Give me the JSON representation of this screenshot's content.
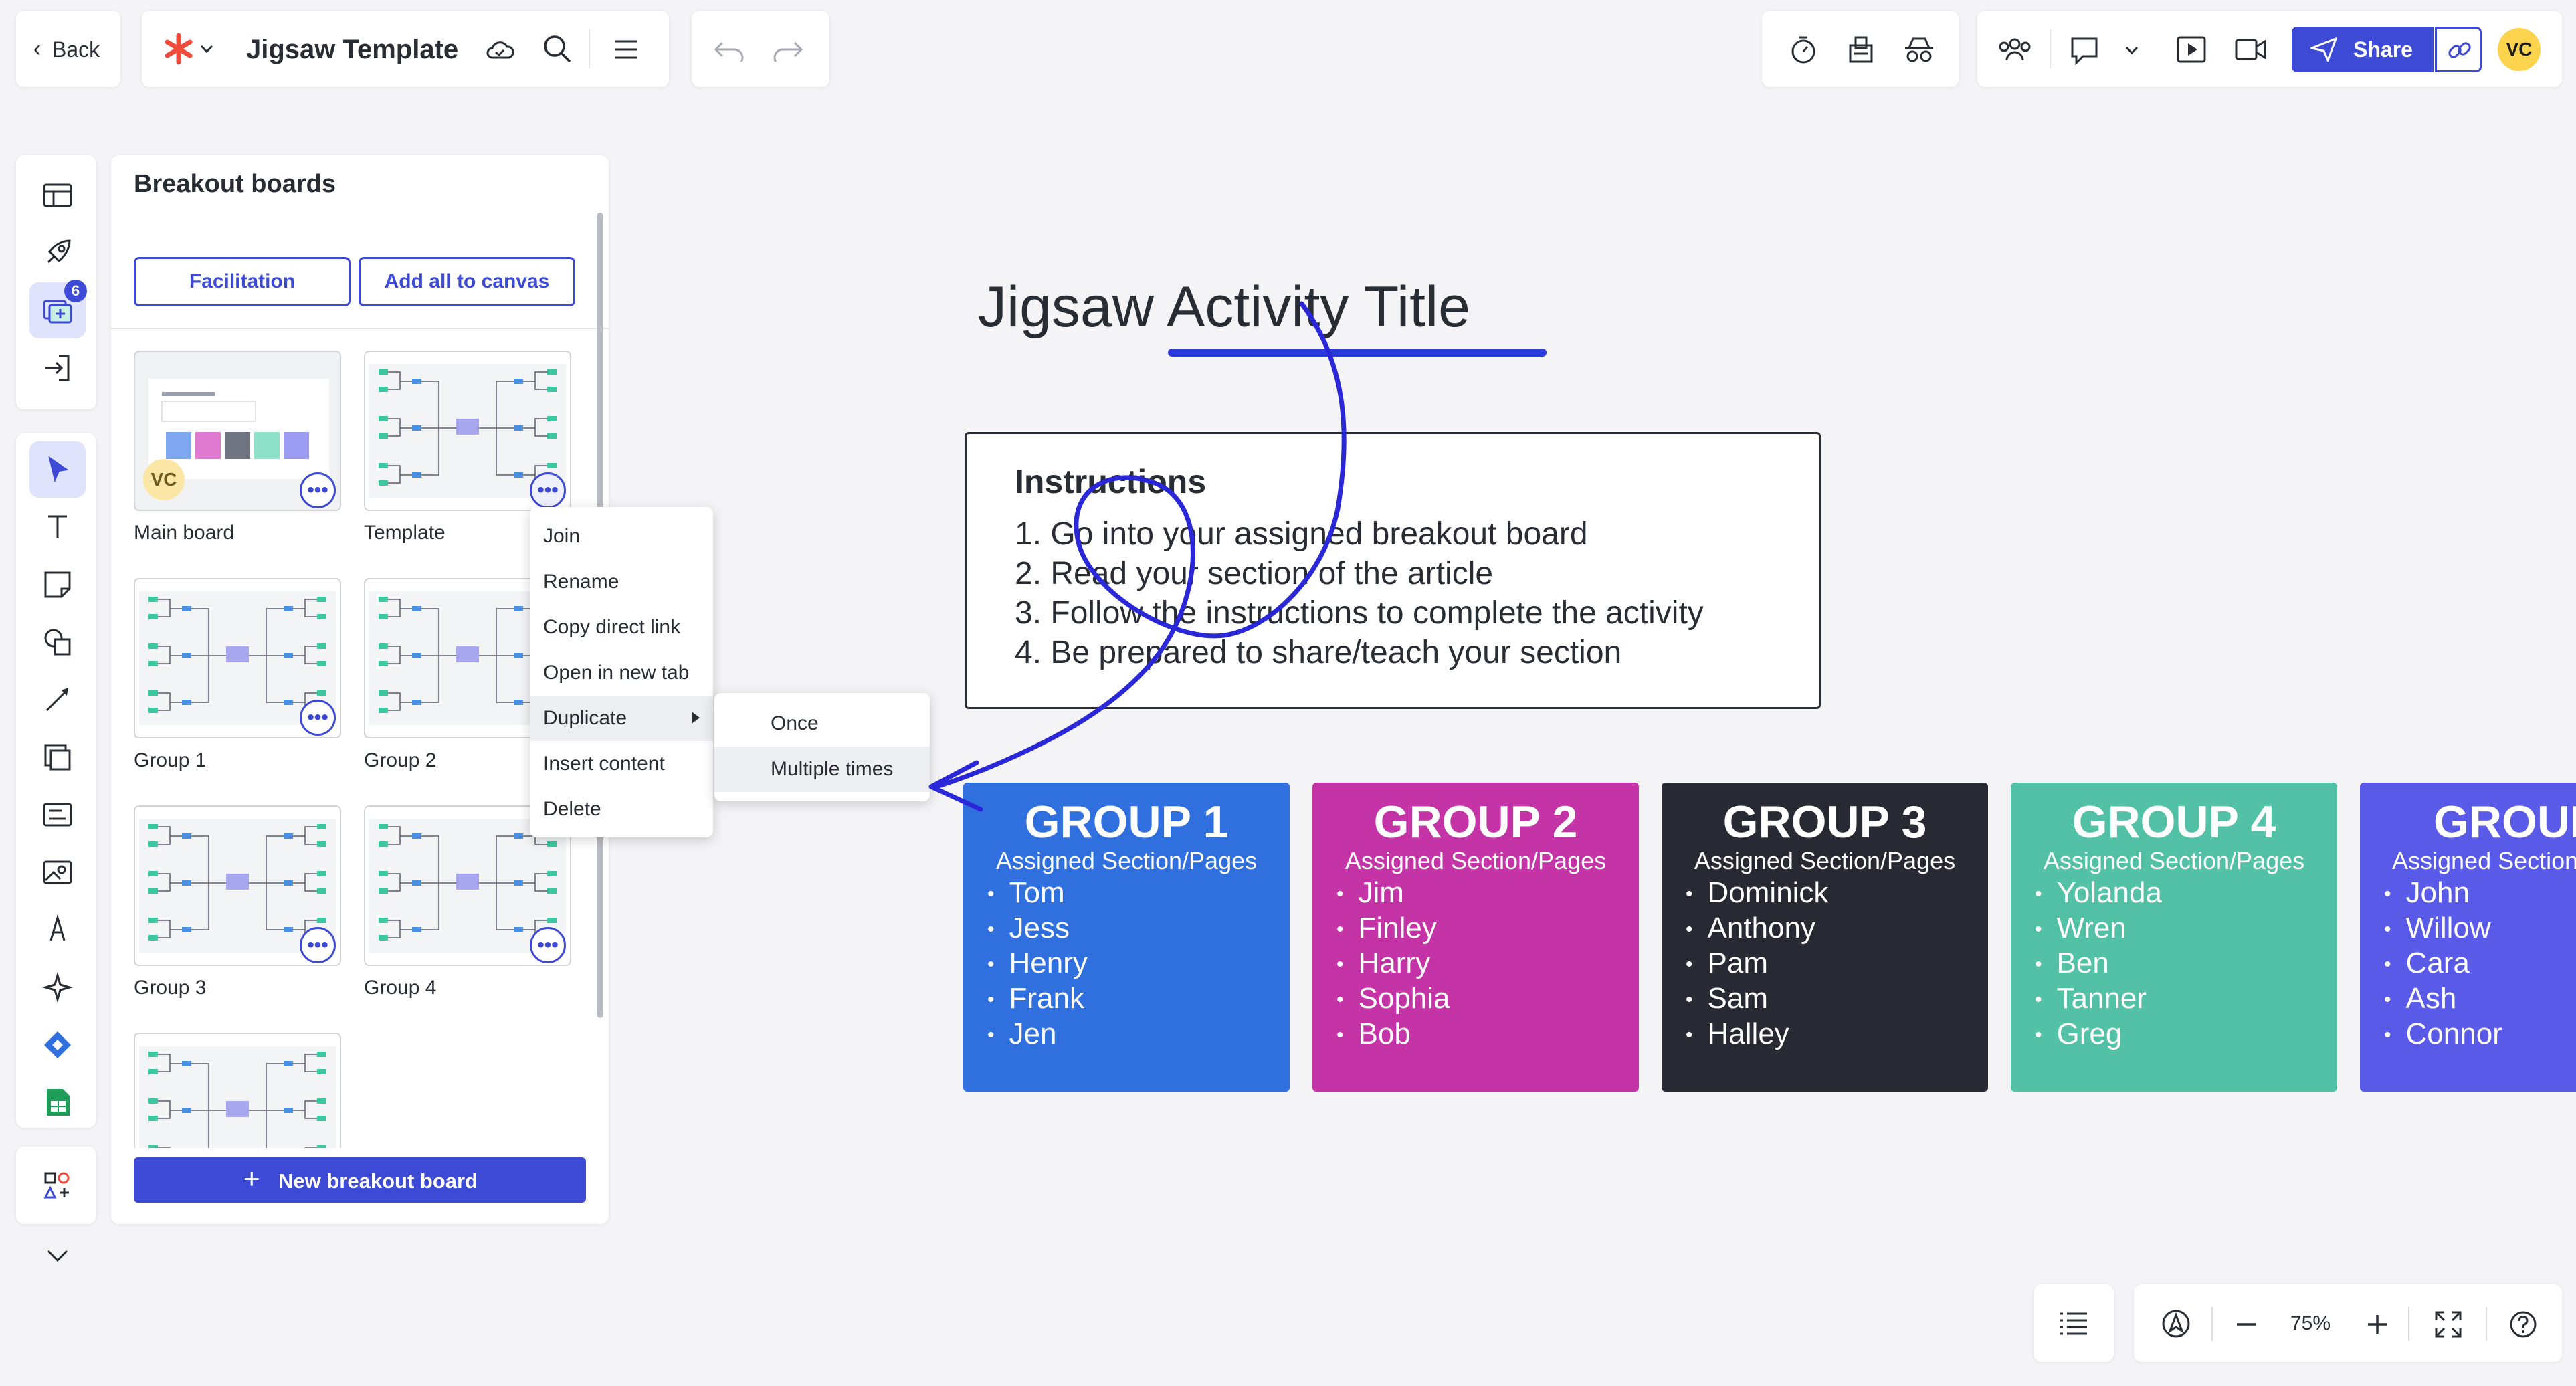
{
  "topbar": {
    "back_label": "Back",
    "doc_title": "Jigsaw Template",
    "share_label": "Share",
    "avatar_initials": "VC"
  },
  "left_rail": {
    "breakout_badge": "6"
  },
  "breakout_panel": {
    "title": "Breakout boards",
    "facilitation_label": "Facilitation",
    "add_all_label": "Add all to canvas",
    "new_board_label": "New breakout board",
    "boards": [
      {
        "label": "Main board",
        "avatar": "VC"
      },
      {
        "label": "Template"
      },
      {
        "label": "Group 1"
      },
      {
        "label": "Group 2"
      },
      {
        "label": "Group 3"
      },
      {
        "label": "Group 4"
      }
    ]
  },
  "context_menu": {
    "items": [
      "Join",
      "Rename",
      "Copy direct link",
      "Open in new tab",
      "Duplicate",
      "Insert content",
      "Delete"
    ],
    "submenu": [
      "Once",
      "Multiple times"
    ]
  },
  "canvas": {
    "title": "Jigsaw Activity Title",
    "instructions_heading": "Instructions",
    "instructions": [
      "1. Go into your assigned breakout board",
      "2. Read your section of the article",
      "3. Follow the instructions to complete the activity",
      "4. Be prepared to share/teach your section"
    ],
    "groups": [
      {
        "title": "GROUP 1",
        "subtitle": "Assigned Section/Pages",
        "members": [
          "Tom",
          "Jess",
          "Henry",
          "Frank",
          "Jen"
        ],
        "color": "#2f6fde"
      },
      {
        "title": "GROUP 2",
        "subtitle": "Assigned Section/Pages",
        "members": [
          "Jim",
          "Finley",
          "Harry",
          "Sophia",
          "Bob"
        ],
        "color": "#c434a6"
      },
      {
        "title": "GROUP 3",
        "subtitle": "Assigned Section/Pages",
        "members": [
          "Dominick",
          "Anthony",
          "Pam",
          "Sam",
          "Halley"
        ],
        "color": "#272a33"
      },
      {
        "title": "GROUP 4",
        "subtitle": "Assigned Section/Pages",
        "members": [
          "Yolanda",
          "Wren",
          "Ben",
          "Tanner",
          "Greg"
        ],
        "color": "#52c1a5"
      },
      {
        "title": "GROUP",
        "subtitle": "Assigned Section",
        "members": [
          "John",
          "Willow",
          "Cara",
          "Ash",
          "Connor"
        ],
        "color": "#5a5ae8"
      }
    ]
  },
  "bottom_bar": {
    "zoom": "75%"
  },
  "colors": {
    "accent": "#3d4ad6",
    "annotation_ink": "#2a27d8"
  }
}
